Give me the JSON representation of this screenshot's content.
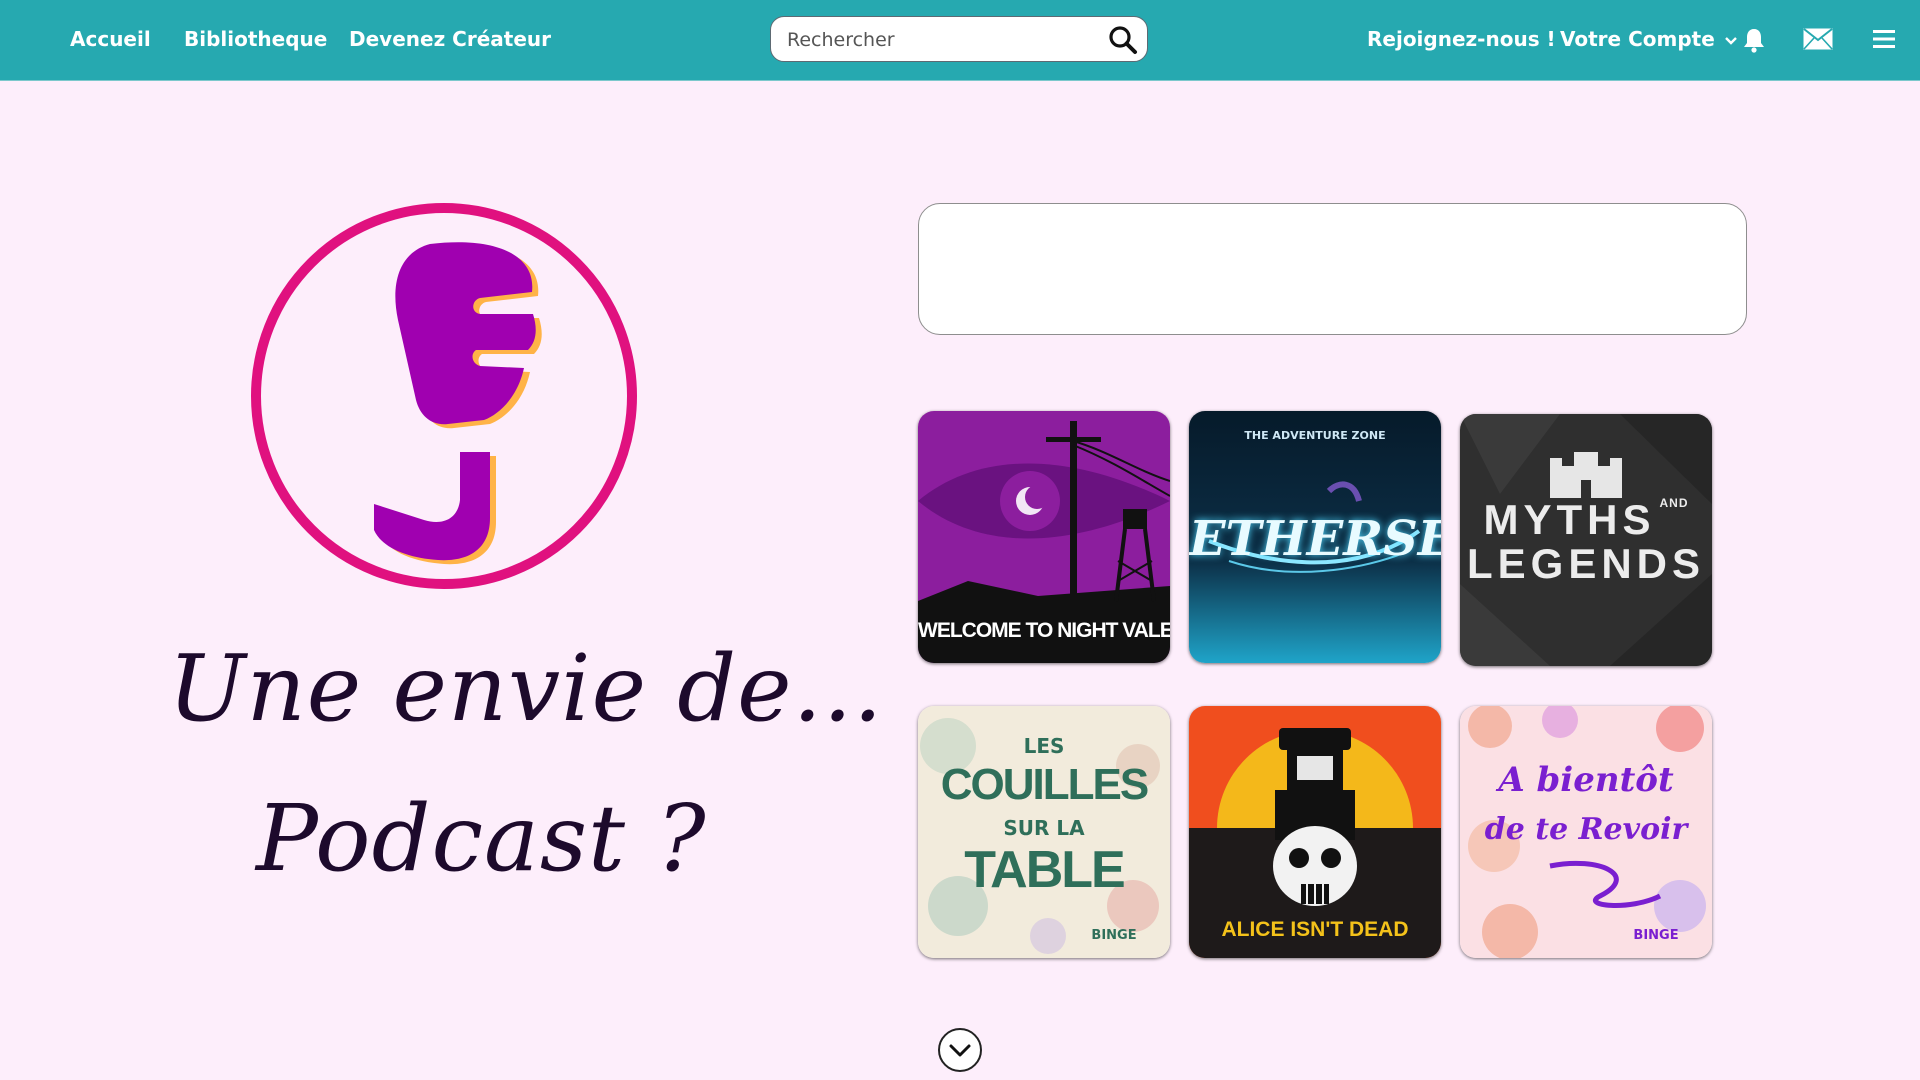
{
  "header": {
    "nav": [
      "Accueil",
      "Bibliotheque",
      "Devenez Créateur"
    ],
    "search_placeholder": "Rechercher",
    "join_label": "Rejoignez-nous !",
    "account_label": "Votre Compte",
    "icons": [
      "search-icon",
      "chevron-down-icon",
      "bell-icon",
      "mail-icon",
      "menu-icon"
    ]
  },
  "hero": {
    "line1": "Une envie de...",
    "line2": "Podcast ?"
  },
  "podcasts": [
    {
      "title": "WELCOME TO NIGHT VALE"
    },
    {
      "title": "ETHERSEA",
      "subtitle": "THE ADVENTURE ZONE"
    },
    {
      "title_line1": "MYTHS",
      "title_small": "AND",
      "title_line2": "LEGENDS"
    },
    {
      "title_top": "LES",
      "title_mid": "COUILLES",
      "title_sur": "SUR LA",
      "title_bottom": "TABLE",
      "brand": "BINGE"
    },
    {
      "title": "ALICE ISN'T DEAD"
    },
    {
      "title_line1": "A bientôt",
      "title_line2": "de te Revoir",
      "brand": "BINGE"
    }
  ],
  "colors": {
    "nav_bg": "#26a9b0",
    "page_bg": "#fdeefb",
    "logo_ring": "#e0117f",
    "logo_mark": "#a000b0",
    "logo_shadow": "#ffb347"
  }
}
